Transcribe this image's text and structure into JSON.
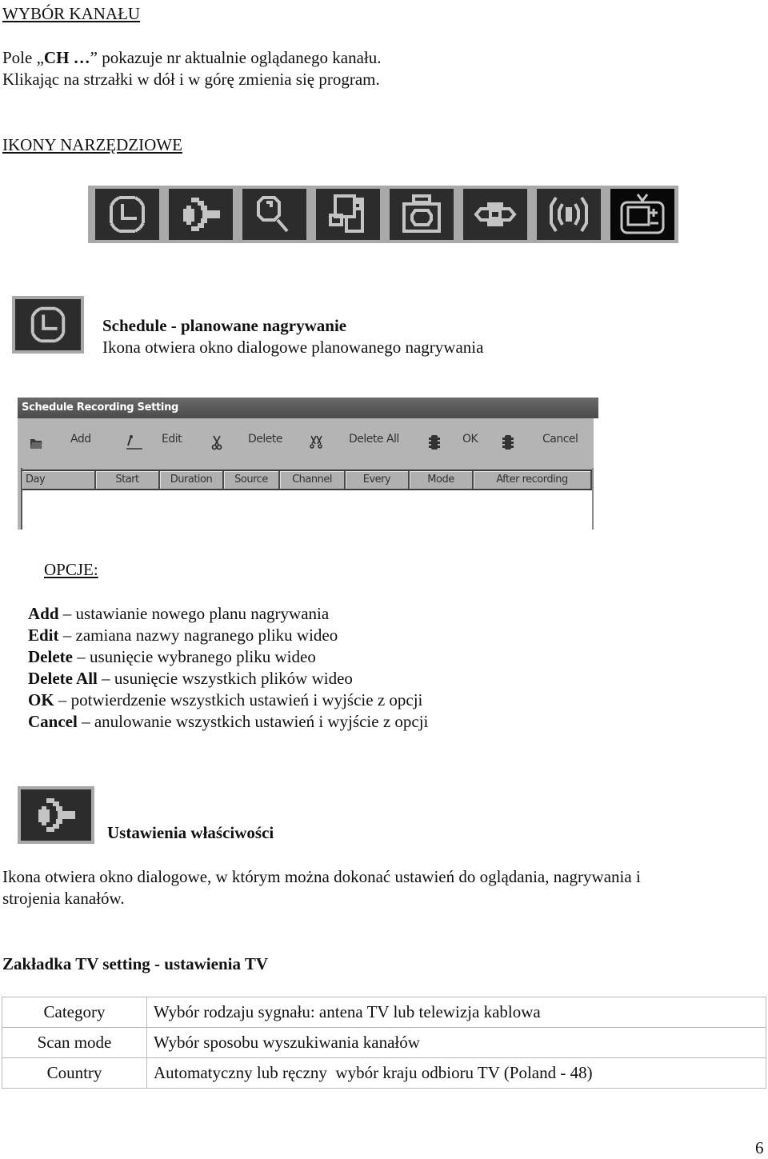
{
  "section_channel": {
    "heading": "WYBÓR KANAŁU",
    "line1_prefix": "Pole „",
    "line1_bold": "CH …",
    "line1_suffix": "” pokazuje nr aktualnie oglądanego kanału.",
    "line2": "Klikając na strzałki w dół i w górę zmienia się program."
  },
  "section_tools": {
    "heading": "IKONY NARZĘDZIOWE",
    "toolbar_icons": [
      {
        "name": "schedule-clock-icon"
      },
      {
        "name": "properties-settings-icon"
      },
      {
        "name": "search-magnifier-icon"
      },
      {
        "name": "windows-layout-icon"
      },
      {
        "name": "snapshot-camera-icon"
      },
      {
        "name": "view-eye-icon"
      },
      {
        "name": "audio-signal-icon"
      },
      {
        "name": "tv-channel-plus-minus-icon"
      }
    ]
  },
  "schedule": {
    "title": "Schedule - planowane nagrywanie",
    "description": "Ikona otwiera okno dialogowe planowanego nagrywania"
  },
  "dialog": {
    "title": "Schedule Recording Setting",
    "toolbar": {
      "add": "Add",
      "edit": "Edit",
      "delete": "Delete",
      "delete_all": "Delete All",
      "ok": "OK",
      "cancel": "Cancel"
    },
    "columns": [
      "Day",
      "Start",
      "Duration",
      "Source",
      "Channel",
      "Every",
      "Mode",
      "After recording"
    ]
  },
  "options": {
    "heading": "OPCJE:",
    "items": [
      {
        "term": "Add",
        "desc": " – ustawianie nowego planu nagrywania"
      },
      {
        "term": "Edit",
        "desc": " – zamiana nazwy nagranego pliku wideo"
      },
      {
        "term": "Delete",
        "desc": " – usunięcie wybranego pliku wideo"
      },
      {
        "term": "Delete All",
        "desc": " – usunięcie wszystkich plików wideo"
      },
      {
        "term": "OK",
        "desc": " – potwierdzenie wszystkich ustawień i wyjście z opcji"
      },
      {
        "term": "Cancel",
        "desc": " – anulowanie wszystkich ustawień i wyjście z opcji"
      }
    ]
  },
  "properties": {
    "title": "Ustawienia właściwości",
    "description_line1": "Ikona otwiera okno dialogowe, w którym można dokonać ustawień do oglądania, nagrywania i",
    "description_line2": "strojenia kanałów."
  },
  "tv_setting": {
    "heading": "Zakładka TV setting - ustawienia TV",
    "rows": [
      {
        "key": "Category",
        "value": "Wybór rodzaju sygnału: antena TV lub telewizja kablowa"
      },
      {
        "key": "Scan mode",
        "value": "Wybór sposobu wyszukiwania kanałów"
      },
      {
        "key": "Country",
        "value": "Automatyczny lub ręczny  wybór kraju odbioru TV (Poland - 48)"
      }
    ]
  },
  "page_number": "6"
}
